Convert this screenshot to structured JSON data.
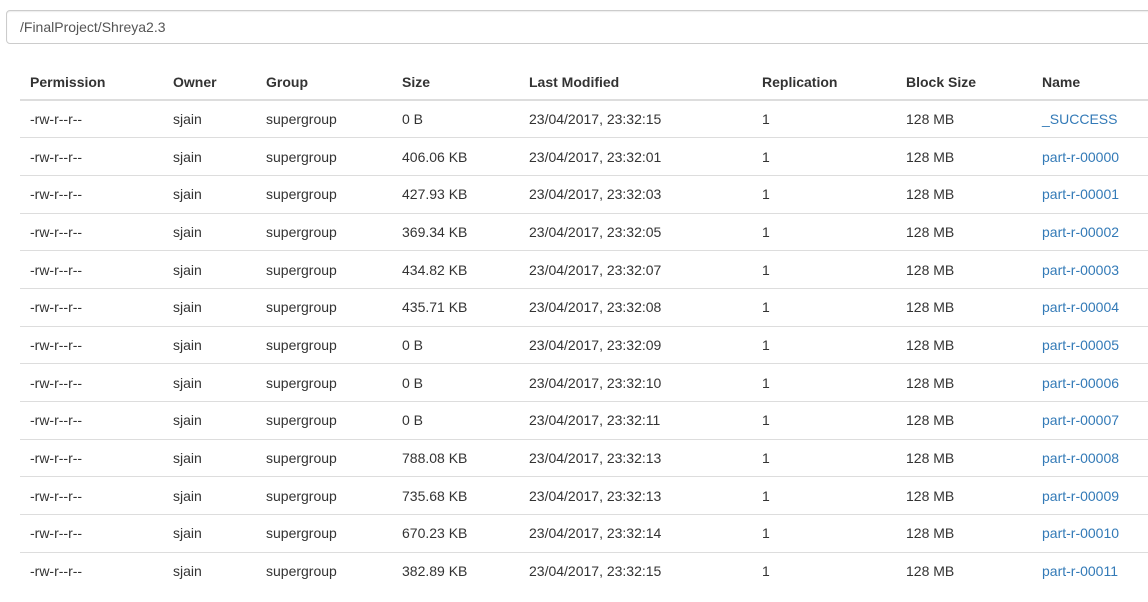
{
  "path": {
    "value": "/FinalProject/Shreya2.3"
  },
  "table": {
    "headers": [
      "Permission",
      "Owner",
      "Group",
      "Size",
      "Last Modified",
      "Replication",
      "Block Size",
      "Name"
    ],
    "rows": [
      {
        "permission": "-rw-r--r--",
        "owner": "sjain",
        "group": "supergroup",
        "size": "0 B",
        "modified": "23/04/2017, 23:32:15",
        "replication": "1",
        "block_size": "128 MB",
        "name": "_SUCCESS"
      },
      {
        "permission": "-rw-r--r--",
        "owner": "sjain",
        "group": "supergroup",
        "size": "406.06 KB",
        "modified": "23/04/2017, 23:32:01",
        "replication": "1",
        "block_size": "128 MB",
        "name": "part-r-00000"
      },
      {
        "permission": "-rw-r--r--",
        "owner": "sjain",
        "group": "supergroup",
        "size": "427.93 KB",
        "modified": "23/04/2017, 23:32:03",
        "replication": "1",
        "block_size": "128 MB",
        "name": "part-r-00001"
      },
      {
        "permission": "-rw-r--r--",
        "owner": "sjain",
        "group": "supergroup",
        "size": "369.34 KB",
        "modified": "23/04/2017, 23:32:05",
        "replication": "1",
        "block_size": "128 MB",
        "name": "part-r-00002"
      },
      {
        "permission": "-rw-r--r--",
        "owner": "sjain",
        "group": "supergroup",
        "size": "434.82 KB",
        "modified": "23/04/2017, 23:32:07",
        "replication": "1",
        "block_size": "128 MB",
        "name": "part-r-00003"
      },
      {
        "permission": "-rw-r--r--",
        "owner": "sjain",
        "group": "supergroup",
        "size": "435.71 KB",
        "modified": "23/04/2017, 23:32:08",
        "replication": "1",
        "block_size": "128 MB",
        "name": "part-r-00004"
      },
      {
        "permission": "-rw-r--r--",
        "owner": "sjain",
        "group": "supergroup",
        "size": "0 B",
        "modified": "23/04/2017, 23:32:09",
        "replication": "1",
        "block_size": "128 MB",
        "name": "part-r-00005"
      },
      {
        "permission": "-rw-r--r--",
        "owner": "sjain",
        "group": "supergroup",
        "size": "0 B",
        "modified": "23/04/2017, 23:32:10",
        "replication": "1",
        "block_size": "128 MB",
        "name": "part-r-00006"
      },
      {
        "permission": "-rw-r--r--",
        "owner": "sjain",
        "group": "supergroup",
        "size": "0 B",
        "modified": "23/04/2017, 23:32:11",
        "replication": "1",
        "block_size": "128 MB",
        "name": "part-r-00007"
      },
      {
        "permission": "-rw-r--r--",
        "owner": "sjain",
        "group": "supergroup",
        "size": "788.08 KB",
        "modified": "23/04/2017, 23:32:13",
        "replication": "1",
        "block_size": "128 MB",
        "name": "part-r-00008"
      },
      {
        "permission": "-rw-r--r--",
        "owner": "sjain",
        "group": "supergroup",
        "size": "735.68 KB",
        "modified": "23/04/2017, 23:32:13",
        "replication": "1",
        "block_size": "128 MB",
        "name": "part-r-00009"
      },
      {
        "permission": "-rw-r--r--",
        "owner": "sjain",
        "group": "supergroup",
        "size": "670.23 KB",
        "modified": "23/04/2017, 23:32:14",
        "replication": "1",
        "block_size": "128 MB",
        "name": "part-r-00010"
      },
      {
        "permission": "-rw-r--r--",
        "owner": "sjain",
        "group": "supergroup",
        "size": "382.89 KB",
        "modified": "23/04/2017, 23:32:15",
        "replication": "1",
        "block_size": "128 MB",
        "name": "part-r-00011"
      }
    ]
  },
  "colors": {
    "link": "#337ab7",
    "text": "#333333",
    "border": "#dddddd"
  }
}
